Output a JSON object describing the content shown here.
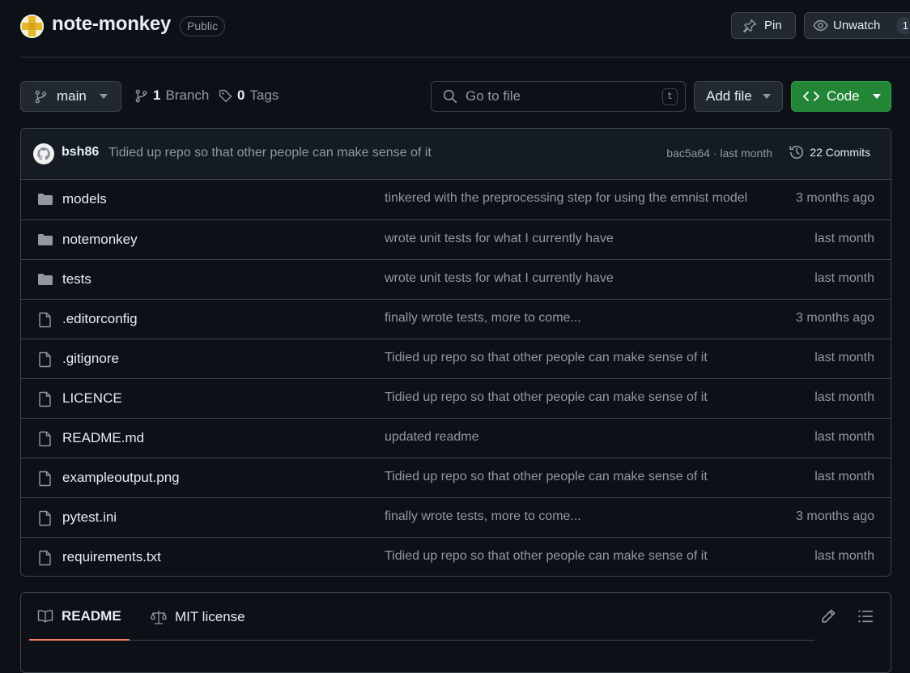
{
  "repo": {
    "name": "note-monkey",
    "visibility": "Public"
  },
  "header_actions": {
    "pin_label": "Pin",
    "unwatch_label": "Unwatch",
    "watch_count": "1"
  },
  "toolbar": {
    "branch": "main",
    "branch_count": "1",
    "branch_label": "Branch",
    "tag_count": "0",
    "tag_label": "Tags",
    "goto_placeholder": "Go to file",
    "goto_shortcut": "t",
    "add_file_label": "Add file",
    "code_label": "Code"
  },
  "latest_commit": {
    "author": "bsh86",
    "message": "Tidied up repo so that other people can make sense of it",
    "sha_time": "bac5a64 · last month",
    "commits_label": "22 Commits"
  },
  "files": [
    {
      "type": "folder",
      "name": "models",
      "commit": "tinkered with the preprocessing step for using the emnist model",
      "date": "3 months ago"
    },
    {
      "type": "folder",
      "name": "notemonkey",
      "commit": "wrote unit tests for what I currently have",
      "date": "last month"
    },
    {
      "type": "folder",
      "name": "tests",
      "commit": "wrote unit tests for what I currently have",
      "date": "last month"
    },
    {
      "type": "file",
      "name": ".editorconfig",
      "commit": "finally wrote tests, more to come...",
      "date": "3 months ago"
    },
    {
      "type": "file",
      "name": ".gitignore",
      "commit": "Tidied up repo so that other people can make sense of it",
      "date": "last month"
    },
    {
      "type": "file",
      "name": "LICENCE",
      "commit": "Tidied up repo so that other people can make sense of it",
      "date": "last month"
    },
    {
      "type": "file",
      "name": "README.md",
      "commit": "updated readme",
      "date": "last month"
    },
    {
      "type": "file",
      "name": "exampleoutput.png",
      "commit": "Tidied up repo so that other people can make sense of it",
      "date": "last month"
    },
    {
      "type": "file",
      "name": "pytest.ini",
      "commit": "finally wrote tests, more to come...",
      "date": "3 months ago"
    },
    {
      "type": "file",
      "name": "requirements.txt",
      "commit": "Tidied up repo so that other people can make sense of it",
      "date": "last month"
    }
  ],
  "readme_tabs": {
    "readme_label": "README",
    "license_label": "MIT license"
  },
  "colors": {
    "background": "#0d1117",
    "border": "#3d444d",
    "code_button": "#238636",
    "tab_underline": "#f78166"
  }
}
